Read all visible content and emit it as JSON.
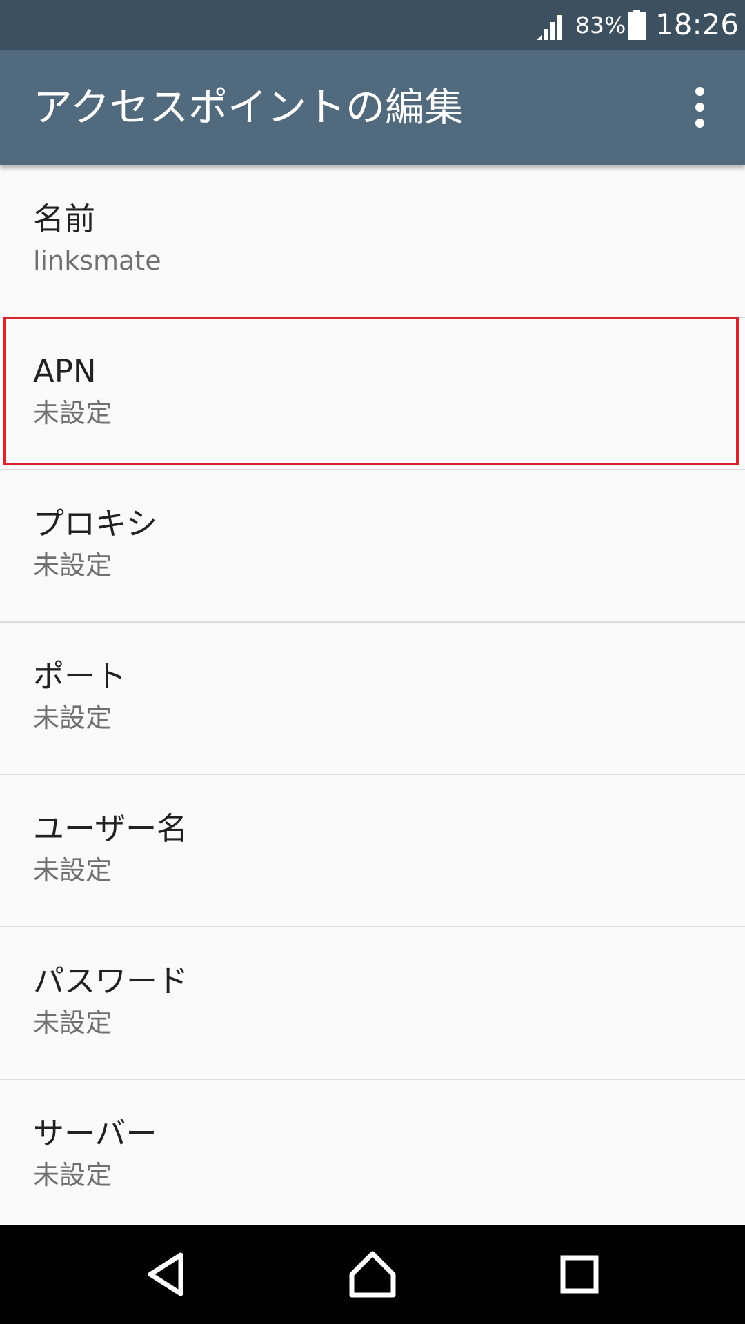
{
  "status_bar": {
    "battery_percent": "83%",
    "time": "18:26"
  },
  "app_bar": {
    "title": "アクセスポイントの編集",
    "overflow_icon": "more-vert-icon"
  },
  "settings": [
    {
      "title": "名前",
      "value": "linksmate"
    },
    {
      "title": "APN",
      "value": "未設定",
      "highlighted": true
    },
    {
      "title": "プロキシ",
      "value": "未設定"
    },
    {
      "title": "ポート",
      "value": "未設定"
    },
    {
      "title": "ユーザー名",
      "value": "未設定"
    },
    {
      "title": "パスワード",
      "value": "未設定"
    },
    {
      "title": "サーバー",
      "value": "未設定"
    }
  ],
  "colors": {
    "status_bar": "#3c5060",
    "app_bar": "#526a7e",
    "highlight": "#d9242c"
  },
  "nav_bar": {
    "icons": [
      "back-icon",
      "home-icon",
      "recents-icon"
    ]
  }
}
